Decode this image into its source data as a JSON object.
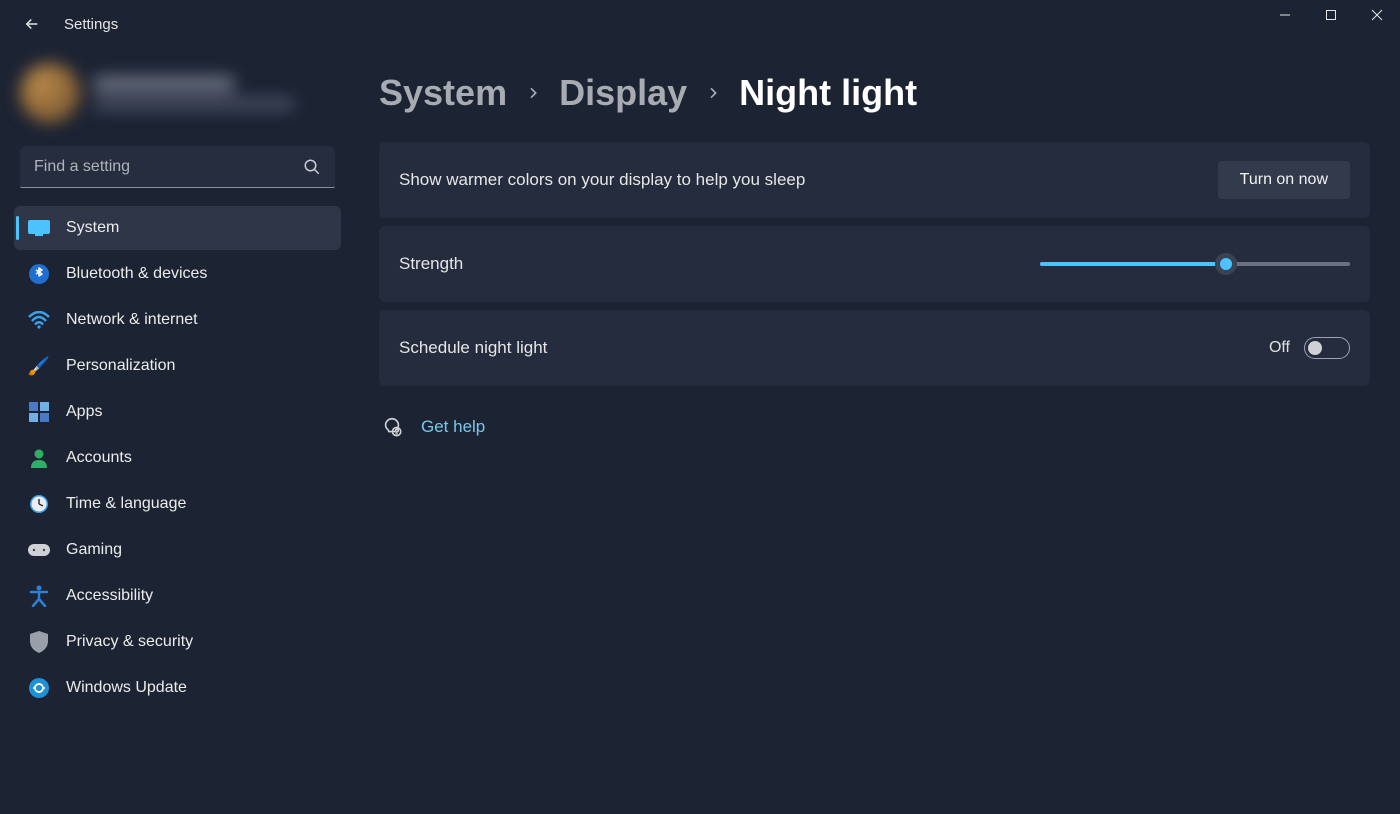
{
  "app": {
    "title": "Settings"
  },
  "search": {
    "placeholder": "Find a setting"
  },
  "sidebar": {
    "items": [
      {
        "label": "System",
        "icon": "🖥️",
        "active": true
      },
      {
        "label": "Bluetooth & devices",
        "icon": "bt"
      },
      {
        "label": "Network & internet",
        "icon": "wifi"
      },
      {
        "label": "Personalization",
        "icon": "🖌️"
      },
      {
        "label": "Apps",
        "icon": "apps"
      },
      {
        "label": "Accounts",
        "icon": "👤"
      },
      {
        "label": "Time & language",
        "icon": "🕒"
      },
      {
        "label": "Gaming",
        "icon": "🎮"
      },
      {
        "label": "Accessibility",
        "icon": "acc"
      },
      {
        "label": "Privacy & security",
        "icon": "🛡️"
      },
      {
        "label": "Windows Update",
        "icon": "🔄"
      }
    ]
  },
  "breadcrumb": {
    "items": [
      "System",
      "Display",
      "Night light"
    ]
  },
  "main": {
    "description": "Show warmer colors on your display to help you sleep",
    "turn_on_label": "Turn on now",
    "strength_label": "Strength",
    "strength_value_percent": 60,
    "schedule_label": "Schedule night light",
    "schedule_state": "Off",
    "schedule_enabled": false
  },
  "help": {
    "label": "Get help"
  },
  "colors": {
    "accent": "#4cc2ff"
  }
}
